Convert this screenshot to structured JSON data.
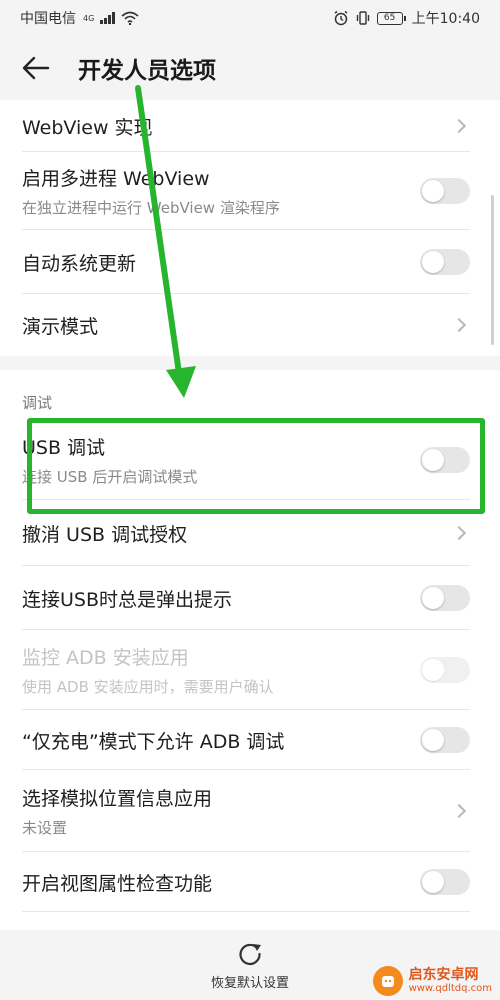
{
  "status_bar": {
    "carrier": "中国电信",
    "network": "4G",
    "battery": "65",
    "time": "上午10:40"
  },
  "header": {
    "title": "开发人员选项",
    "back_icon": "back-arrow-icon"
  },
  "top_rows": [
    {
      "title": "WebView 实现",
      "control": "chevron"
    },
    {
      "title": "启用多进程 WebView",
      "subtitle": "在独立进程中运行 WebView 渲染程序",
      "control": "toggle",
      "on": false
    },
    {
      "title": "自动系统更新",
      "control": "toggle",
      "on": false
    },
    {
      "title": "演示模式",
      "control": "chevron"
    }
  ],
  "section": {
    "label": "调试"
  },
  "debug_rows": [
    {
      "title": "USB 调试",
      "subtitle": "连接 USB 后开启调试模式",
      "control": "toggle",
      "on": false
    },
    {
      "title": "撤消 USB 调试授权",
      "control": "chevron"
    },
    {
      "title": "连接USB时总是弹出提示",
      "control": "toggle",
      "on": false
    },
    {
      "title": "监控 ADB 安装应用",
      "subtitle": "使用 ADB 安装应用时，需要用户确认",
      "control": "toggle",
      "on": false,
      "disabled": true
    },
    {
      "title": "“仅充电”模式下允许 ADB 调试",
      "control": "toggle",
      "on": false
    },
    {
      "title": "选择模拟位置信息应用",
      "subtitle": "未设置",
      "control": "chevron"
    },
    {
      "title": "开启视图属性检查功能",
      "control": "toggle",
      "on": false
    }
  ],
  "bottom": {
    "restore_label": "恢复默认设置",
    "restore_icon": "restore-icon"
  },
  "watermark": {
    "name": "启东安卓网",
    "url": "www.qdltdq.com"
  },
  "colors": {
    "annotation_green": "#26b52d",
    "background": "#f4f4f4",
    "toggle_off": "#e6e6e6",
    "watermark_orange": "#f28a1c"
  }
}
